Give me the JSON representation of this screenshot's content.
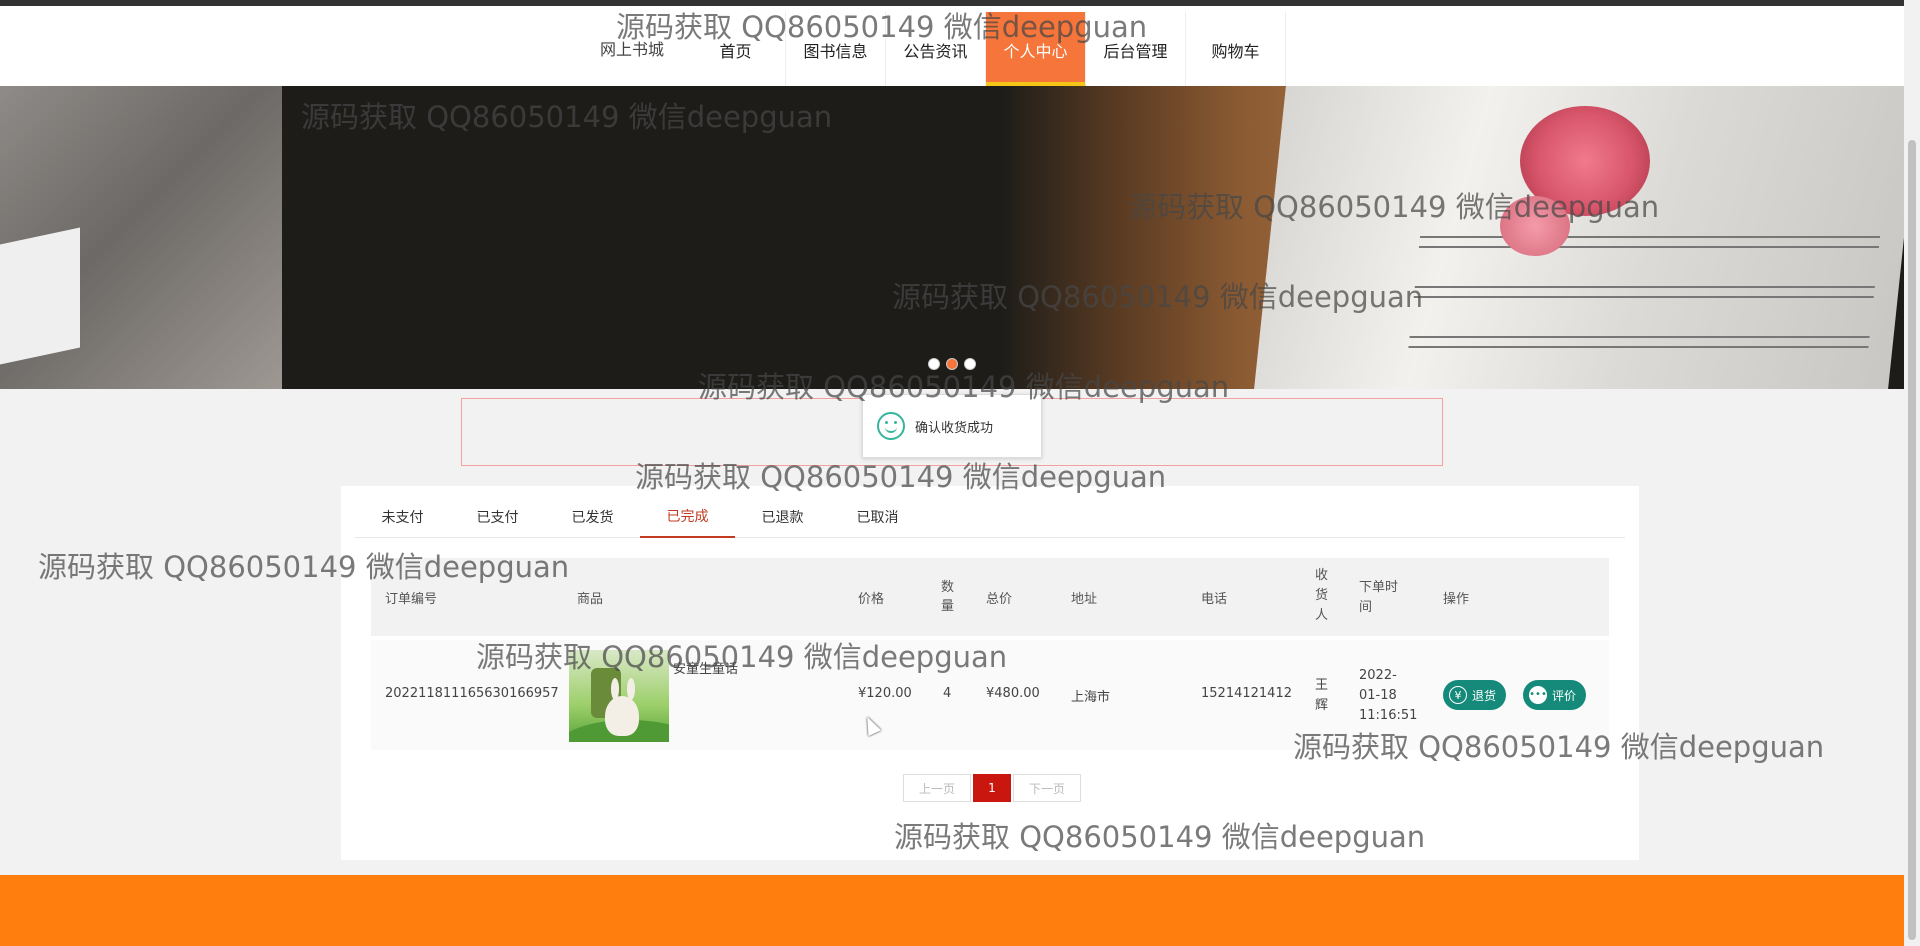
{
  "header": {
    "brand": "网上书城",
    "nav": [
      {
        "label": "首页"
      },
      {
        "label": "图书信息"
      },
      {
        "label": "公告资讯"
      },
      {
        "label": "个人中心",
        "active": true
      },
      {
        "label": "后台管理"
      },
      {
        "label": "购物车"
      }
    ]
  },
  "banner": {
    "dot_count": 3,
    "active_dot": 1
  },
  "toast": {
    "text": "确认收货成功",
    "icon": "smile-icon"
  },
  "tabs": [
    {
      "label": "未支付"
    },
    {
      "label": "已支付"
    },
    {
      "label": "已发货"
    },
    {
      "label": "已完成",
      "active": true
    },
    {
      "label": "已退款"
    },
    {
      "label": "已取消"
    }
  ],
  "table": {
    "headers": {
      "order_no": "订单编号",
      "product": "商品",
      "price": "价格",
      "qty": "数量",
      "total": "总价",
      "address": "地址",
      "phone": "电话",
      "receiver": "收货人",
      "time": "下单时间",
      "ops": "操作"
    },
    "rows": [
      {
        "order_no": "20221181116563016695​7",
        "product": "安童生童话",
        "price": "¥120.00",
        "qty": "4",
        "total": "¥480.00",
        "address": "上海市",
        "phone": "15214121412",
        "receiver": "王辉",
        "time": "2022-01-18 11:16:51",
        "ops": [
          {
            "label": "退货",
            "icon": "yuan-icon"
          },
          {
            "label": "评价",
            "icon": "chat-icon"
          }
        ]
      }
    ]
  },
  "pagination": {
    "prev": "上一页",
    "current": "1",
    "next": "下一页"
  },
  "watermark": "源码获取 QQ86050149 微信deepguan",
  "colors": {
    "nav_active": "#f5753a",
    "tab_active": "#c23b22",
    "op_button": "#168a7a",
    "pager_current": "#c9160f",
    "footer": "#ff7e0d"
  }
}
